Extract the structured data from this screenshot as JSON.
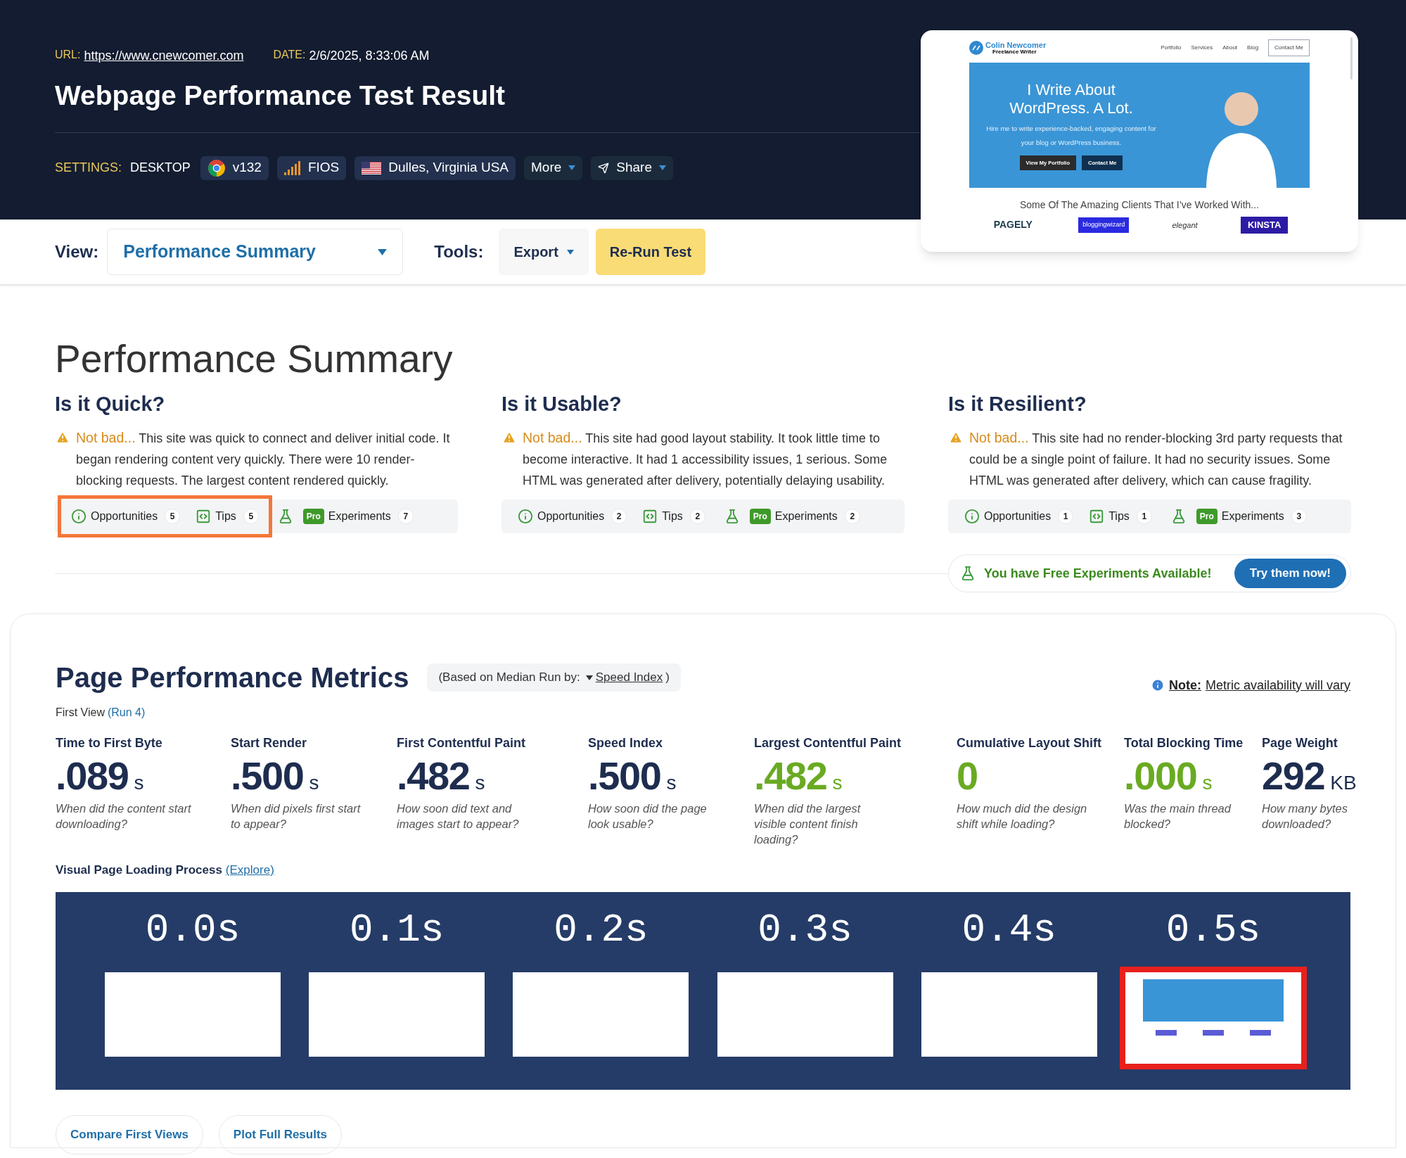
{
  "header": {
    "url_label": "URL:",
    "url": "https://www.cnewcomer.com",
    "date_label": "DATE:",
    "date": "2/6/2025, 8:33:06 AM",
    "title": "Webpage Performance Test Result",
    "settings": {
      "label": "SETTINGS:",
      "device": "DESKTOP",
      "chips": [
        {
          "kind": "browser",
          "label": "v132"
        },
        {
          "kind": "connection",
          "label": "FIOS"
        },
        {
          "kind": "location",
          "label": "Dulles, Virginia USA"
        },
        {
          "kind": "menu",
          "label": "More"
        },
        {
          "kind": "share",
          "label": "Share"
        }
      ]
    }
  },
  "toolbar": {
    "view_label": "View:",
    "view_value": "Performance Summary",
    "tools_label": "Tools:",
    "export": "Export",
    "rerun": "Re-Run Test"
  },
  "preview": {
    "brand": "Colin Newcomer",
    "tagline": "Freelance Writer",
    "nav": [
      {
        "label": "Portfolio",
        "outlined": false
      },
      {
        "label": "Services",
        "outlined": false
      },
      {
        "label": "About",
        "outlined": false
      },
      {
        "label": "Blog",
        "outlined": false
      },
      {
        "label": "Contact Me",
        "outlined": true
      }
    ],
    "hero_title": "I Write About WordPress. A Lot.",
    "hero_text": "Hire me to write experience-backed, engaging content for your blog or WordPress business.",
    "hero_buttons": [
      "View My Portfolio",
      "Contact Me"
    ],
    "clients_heading": "Some Of The Amazing Clients That I’ve Worked With...",
    "clients": [
      "PAGELY",
      "bloggingwizard",
      "elegant",
      "KINSTA"
    ]
  },
  "summary": {
    "title": "Performance Summary",
    "columns": [
      {
        "heading": "Is it Quick?",
        "verdict": "Not bad...",
        "text": "This site was quick to connect and deliver initial code. It began rendering content very quickly. There were 10 render-blocking requests. The largest content rendered quickly.",
        "highlighted": true,
        "opportunities": {
          "label": "Opportunities",
          "count": "5"
        },
        "tips": {
          "label": "Tips",
          "count": "5"
        },
        "experiments": {
          "badge": "Pro",
          "label": "Experiments",
          "count": "7"
        }
      },
      {
        "heading": "Is it Usable?",
        "verdict": "Not bad...",
        "text": "This site had good layout stability. It took little time to become interactive. It had 1 accessibility issues, 1 serious. Some HTML was generated after delivery, potentially delaying usability.",
        "highlighted": false,
        "opportunities": {
          "label": "Opportunities",
          "count": "2"
        },
        "tips": {
          "label": "Tips",
          "count": "2"
        },
        "experiments": {
          "badge": "Pro",
          "label": "Experiments",
          "count": "2"
        }
      },
      {
        "heading": "Is it Resilient?",
        "verdict": "Not bad...",
        "text": "This site had no render-blocking 3rd party requests that could be a single point of failure. It had no security issues. Some HTML was generated after delivery, which can cause fragility.",
        "highlighted": false,
        "opportunities": {
          "label": "Opportunities",
          "count": "1"
        },
        "tips": {
          "label": "Tips",
          "count": "1"
        },
        "experiments": {
          "badge": "Pro",
          "label": "Experiments",
          "count": "3"
        }
      }
    ],
    "promo": {
      "text": "You have Free Experiments Available!",
      "button": "Try them now!"
    }
  },
  "metrics": {
    "title": "Page Performance Metrics",
    "median_prefix": "(Based on Median Run by:",
    "median_metric": "Speed Index",
    "median_suffix": ")",
    "note_label": "Note:",
    "note_text": "Metric availability will vary",
    "first_view": "First View",
    "run_link": "(Run 4)",
    "items": [
      {
        "label": "Time to First Byte",
        "value": ".089",
        "unit": "s",
        "description": "When did the content start downloading?",
        "good": false
      },
      {
        "label": "Start Render",
        "value": ".500",
        "unit": "s",
        "description": "When did pixels first start to appear?",
        "good": false
      },
      {
        "label": "First Contentful Paint",
        "value": ".482",
        "unit": "s",
        "description": "How soon did text and images start to appear?",
        "good": false
      },
      {
        "label": "Speed Index",
        "value": ".500",
        "unit": "s",
        "description": "How soon did the page look usable?",
        "good": false
      },
      {
        "label": "Largest Contentful Paint",
        "value": ".482",
        "unit": "s",
        "description": "When did the largest visible content finish loading?",
        "good": true
      },
      {
        "label": "Cumulative Layout Shift",
        "value": "0",
        "description": "How much did the design shift while loading?",
        "good": true
      },
      {
        "label": "Total Blocking Time",
        "value": ".000",
        "unit": "s",
        "description": "Was the main thread blocked?",
        "good": true
      },
      {
        "label": "Page Weight",
        "value": "292",
        "unit": "KB",
        "description": "How many bytes downloaded?",
        "good": false
      }
    ],
    "visual_label": "Visual Page Loading Process",
    "explore_link": "(Explore)",
    "frames": [
      {
        "time": "0.0s",
        "kind": "blank",
        "highlighted": false
      },
      {
        "time": "0.1s",
        "kind": "blank",
        "highlighted": false
      },
      {
        "time": "0.2s",
        "kind": "blank",
        "highlighted": false
      },
      {
        "time": "0.3s",
        "kind": "blank",
        "highlighted": false
      },
      {
        "time": "0.4s",
        "kind": "blank",
        "highlighted": false
      },
      {
        "time": "0.5s",
        "kind": "screenshot",
        "highlighted": true
      }
    ],
    "buttons": [
      "Compare First Views",
      "Plot Full Results"
    ]
  }
}
